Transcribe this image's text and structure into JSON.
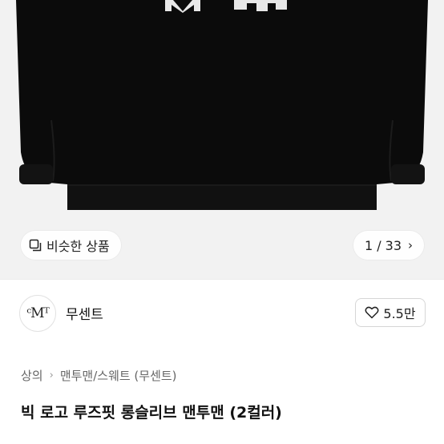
{
  "hero": {
    "similar_label": "비슷한 상품",
    "counter": "1 / 33",
    "chevron": "›"
  },
  "seller": {
    "logo_text": "ᶜMᵀ",
    "name": "무센트",
    "likes_label": "5.5만"
  },
  "breadcrumb": {
    "items": [
      "상의",
      "맨투맨/스웨트 (무센트)"
    ],
    "separator": "›"
  },
  "product": {
    "title": "빅 로고 루즈핏 롱슬리브 맨투맨 (2컬러)"
  },
  "colors": {
    "garment": "#0b0b0b",
    "background": "#f2f2f2"
  }
}
